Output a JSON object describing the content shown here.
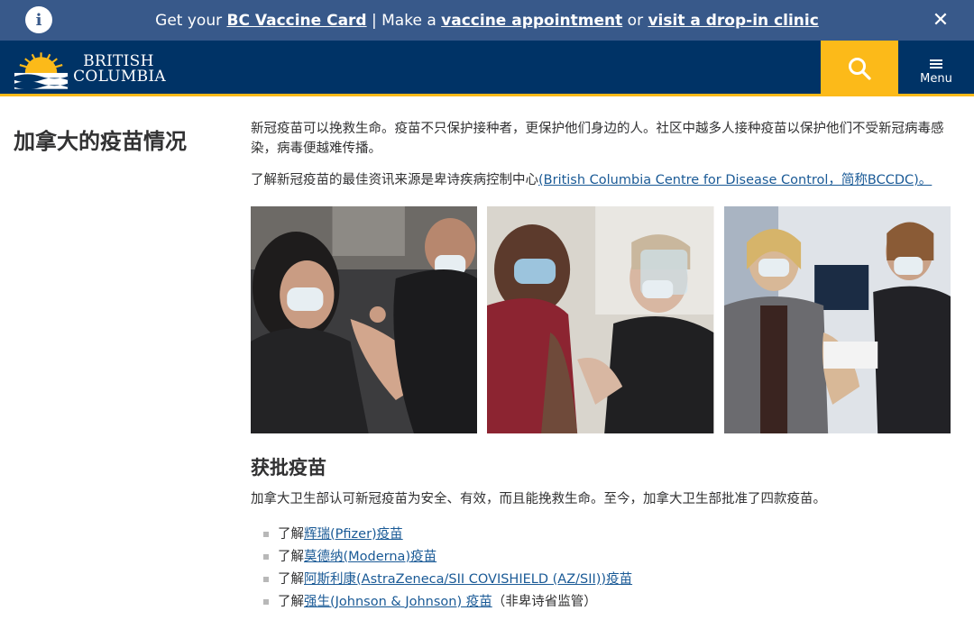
{
  "banner": {
    "icon": "info-icon",
    "text_1": "Get your ",
    "link_1": "BC Vaccine Card",
    "text_2": " | Make a ",
    "link_2": "vaccine appointment",
    "text_3": " or ",
    "link_3": "visit a drop-in clinic",
    "close_icon": "close-icon",
    "bg_color": "#38598a"
  },
  "header": {
    "logo_line1": "BRITISH",
    "logo_line2": "COLUMBIA",
    "search_icon": "search-icon",
    "menu_label": "Menu",
    "bg_color": "#003366",
    "accent_color": "#fcba19"
  },
  "sidebar": {
    "title": "加拿大的疫苗情况"
  },
  "main": {
    "intro": "新冠疫苗可以挽救生命。疫苗不只保护接种者，更保护他们身边的人。社区中越多人接种疫苗以保护他们不受新冠病毒感染，病毒便越难传播。",
    "info_prefix": "了解新冠疫苗的最佳资讯来源是卑诗疾病控制中心",
    "info_link": "(British Columbia Centre for Disease Control，简称BCCDC)。",
    "section_title": "获批疫苗",
    "section_text": "加拿大卫生部认可新冠疫苗为安全、有效，而且能挽救生命。至今，加拿大卫生部批准了四款疫苗。",
    "vaccines": [
      {
        "prefix": "了解",
        "link": "辉瑞(Pfizer)疫苗",
        "suffix": ""
      },
      {
        "prefix": "了解",
        "link": "莫德纳(Moderna)疫苗",
        "suffix": ""
      },
      {
        "prefix": "了解 ",
        "link": "阿斯利康(AstraZeneca/SII COVISHIELD (AZ/SII))疫苗",
        "suffix": ""
      },
      {
        "prefix": "了解",
        "link": "强生(Johnson & Johnson) 疫苗",
        "suffix": " （非卑诗省监管）"
      }
    ]
  }
}
